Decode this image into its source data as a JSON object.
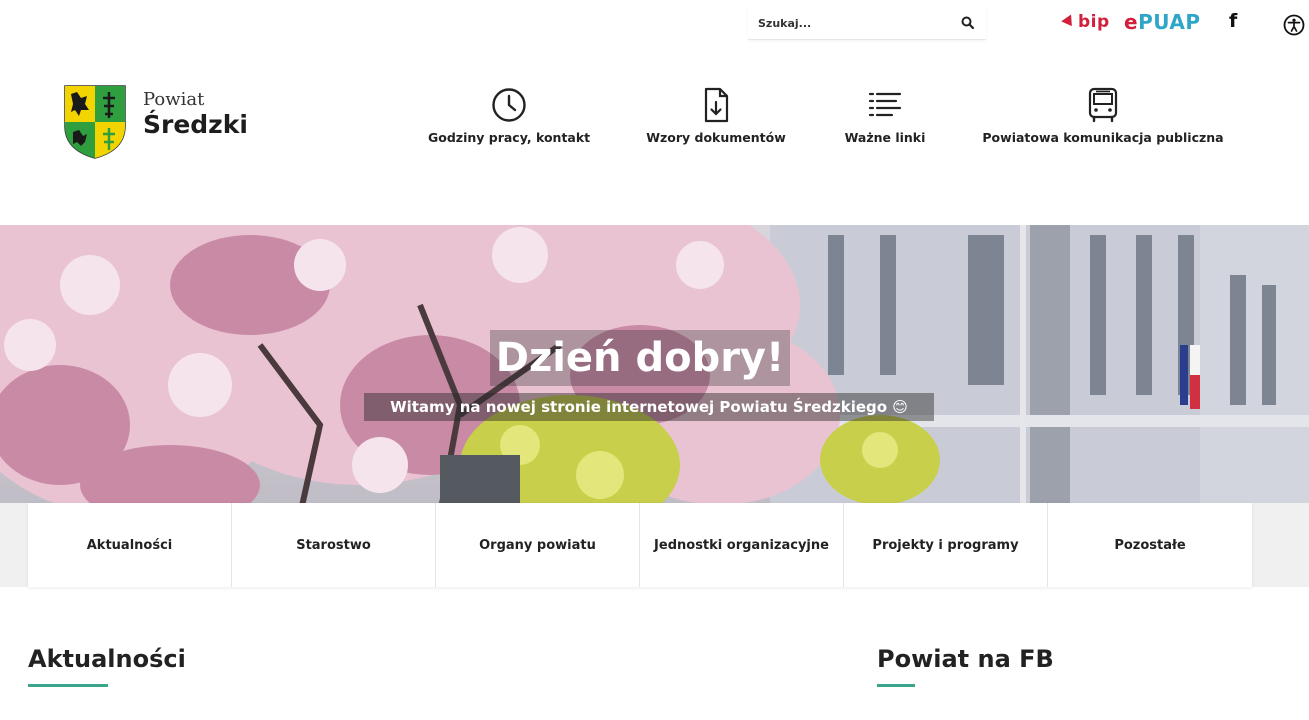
{
  "search": {
    "placeholder": "Szukaj..."
  },
  "top_links": {
    "bip": "bip",
    "epuap_e": "e",
    "epuap_rest": "PUAP",
    "facebook": "f"
  },
  "brand": {
    "line1": "Powiat",
    "line2": "Średzki"
  },
  "quick_links": [
    {
      "label": "Godziny pracy, kontakt",
      "icon": "clock-icon"
    },
    {
      "label": "Wzory dokumentów",
      "icon": "document-download-icon"
    },
    {
      "label": "Ważne linki",
      "icon": "list-icon"
    },
    {
      "label": "Powiatowa komunikacja publiczna",
      "icon": "bus-icon"
    }
  ],
  "hero": {
    "title": "Dzień dobry!",
    "subtitle": "Witamy na nowej stronie internetowej Powiatu Średzkiego 😊"
  },
  "menu": [
    "Aktualności",
    "Starostwo",
    "Organy powiatu",
    "Jednostki organizacyjne",
    "Projekty i programy",
    "Pozostałe"
  ],
  "sections": {
    "news": "Aktualności",
    "fb": "Powiat na FB"
  },
  "colors": {
    "accent": "#3aa58a",
    "bip": "#d21f3c",
    "epuap": "#2fa6c8"
  }
}
